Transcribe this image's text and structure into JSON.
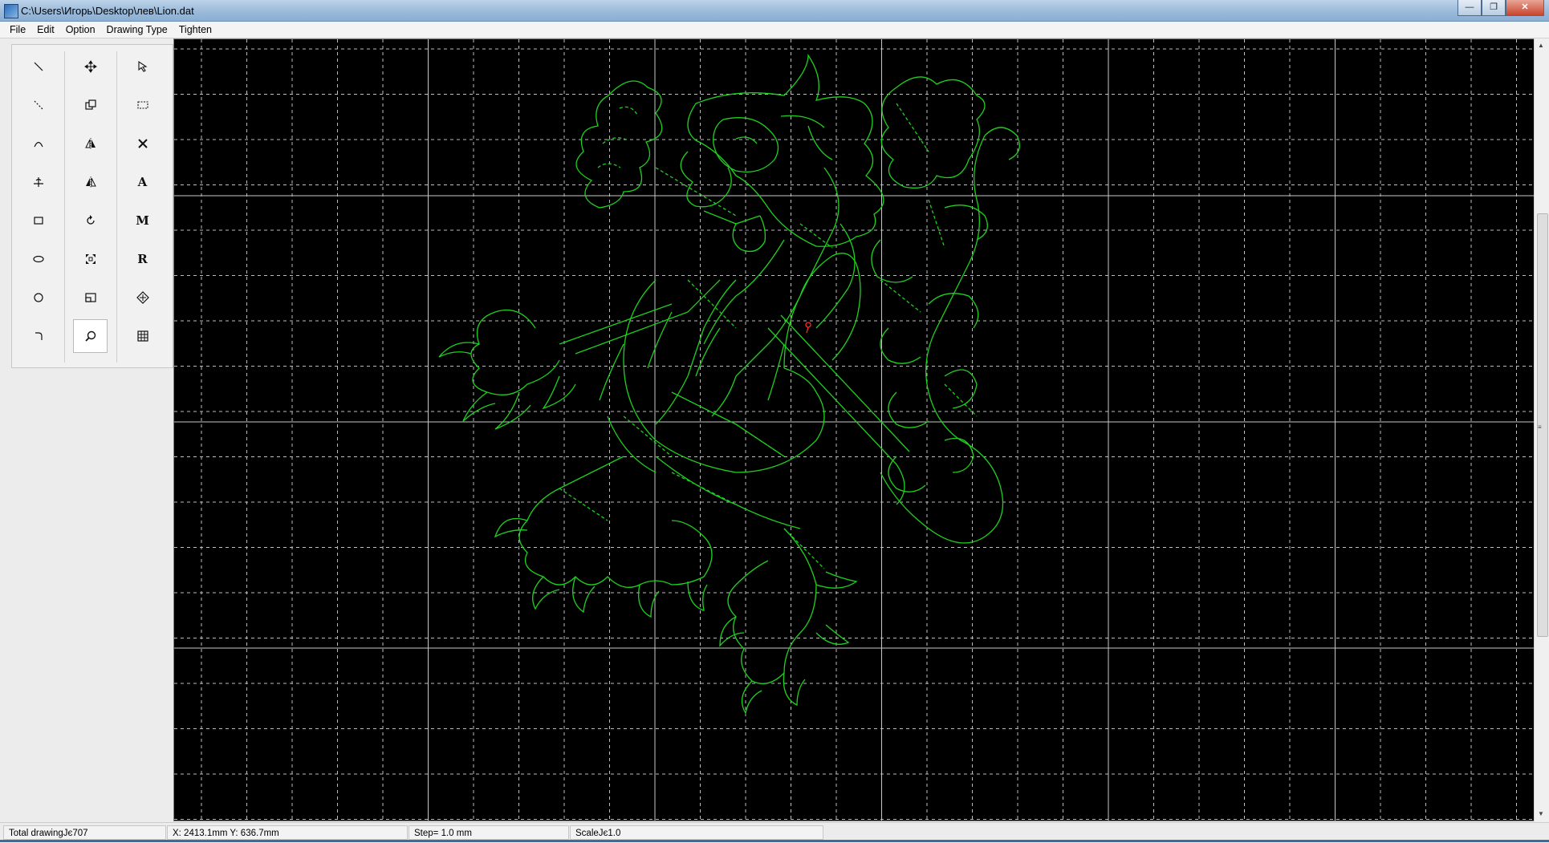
{
  "window": {
    "title": "C:\\Users\\Игорь\\Desktop\\лев\\Lion.dat"
  },
  "menu": [
    "File",
    "Edit",
    "Option",
    "Drawing Type",
    "Tighten"
  ],
  "toolbox": {
    "col1": [
      "line-tool-icon",
      "dashed-line-tool-icon",
      "arc-tool-icon",
      "perpendicular-tool-icon",
      "rectangle-tool-icon",
      "ellipse-tool-icon",
      "circle-tool-icon",
      "corner-arc-tool-icon"
    ],
    "col2": [
      "move-tool-icon",
      "copy-tool-icon",
      "mirror-vertical-tool-icon",
      "mirror-horizontal-tool-icon",
      "rotate-tool-icon",
      "scale-tool-icon",
      "offset-tool-icon",
      "zoom-tool-icon"
    ],
    "col3_labels": {
      "text": "A",
      "measure": "M",
      "radius": "R"
    },
    "active_tool": "zoom-tool-icon"
  },
  "canvas": {
    "background": "#000000",
    "major_grid_color": "#c8c8c8",
    "minor_grid_color": "#bdbdbd",
    "drawing_color": "#1fd11f",
    "marker_color": "#ff2a2a"
  },
  "status": {
    "total": "Total drawingЈє707",
    "coords": "X: 2413.1mm   Y: 636.7mm",
    "step": "Step= 1.0 mm",
    "scale": "ScaleЈє1.0"
  }
}
